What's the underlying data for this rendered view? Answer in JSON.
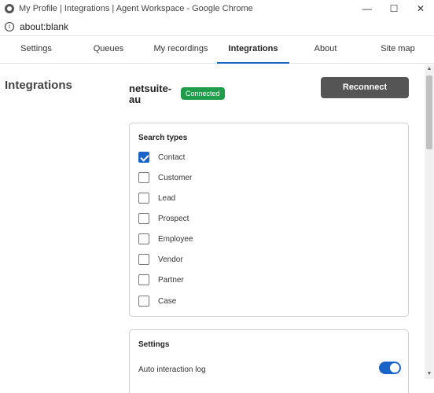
{
  "window": {
    "title": "My Profile | Integrations | Agent Workspace - Google Chrome",
    "minimize": "—",
    "maximize": "☐",
    "close": "✕"
  },
  "address_bar": {
    "info_icon": "i",
    "url": "about:blank"
  },
  "nav": {
    "tabs": [
      {
        "label": "Settings"
      },
      {
        "label": "Queues"
      },
      {
        "label": "My recordings"
      },
      {
        "label": "Integrations",
        "active": true
      },
      {
        "label": "About"
      },
      {
        "label": "Site map"
      }
    ]
  },
  "page": {
    "title": "Integrations",
    "account": "netsuite-au",
    "status_badge": "Connected",
    "reconnect_label": "Reconnect"
  },
  "search_types": {
    "title": "Search types",
    "items": [
      {
        "label": "Contact",
        "checked": true
      },
      {
        "label": "Customer",
        "checked": false
      },
      {
        "label": "Lead",
        "checked": false
      },
      {
        "label": "Prospect",
        "checked": false
      },
      {
        "label": "Employee",
        "checked": false
      },
      {
        "label": "Vendor",
        "checked": false
      },
      {
        "label": "Partner",
        "checked": false
      },
      {
        "label": "Case",
        "checked": false
      }
    ]
  },
  "settings": {
    "title": "Settings",
    "items": [
      {
        "label": "Auto interaction log",
        "enabled": true
      }
    ]
  },
  "colors": {
    "accent": "#1a64c8",
    "connected": "#1f9d4a",
    "button": "#555555"
  }
}
